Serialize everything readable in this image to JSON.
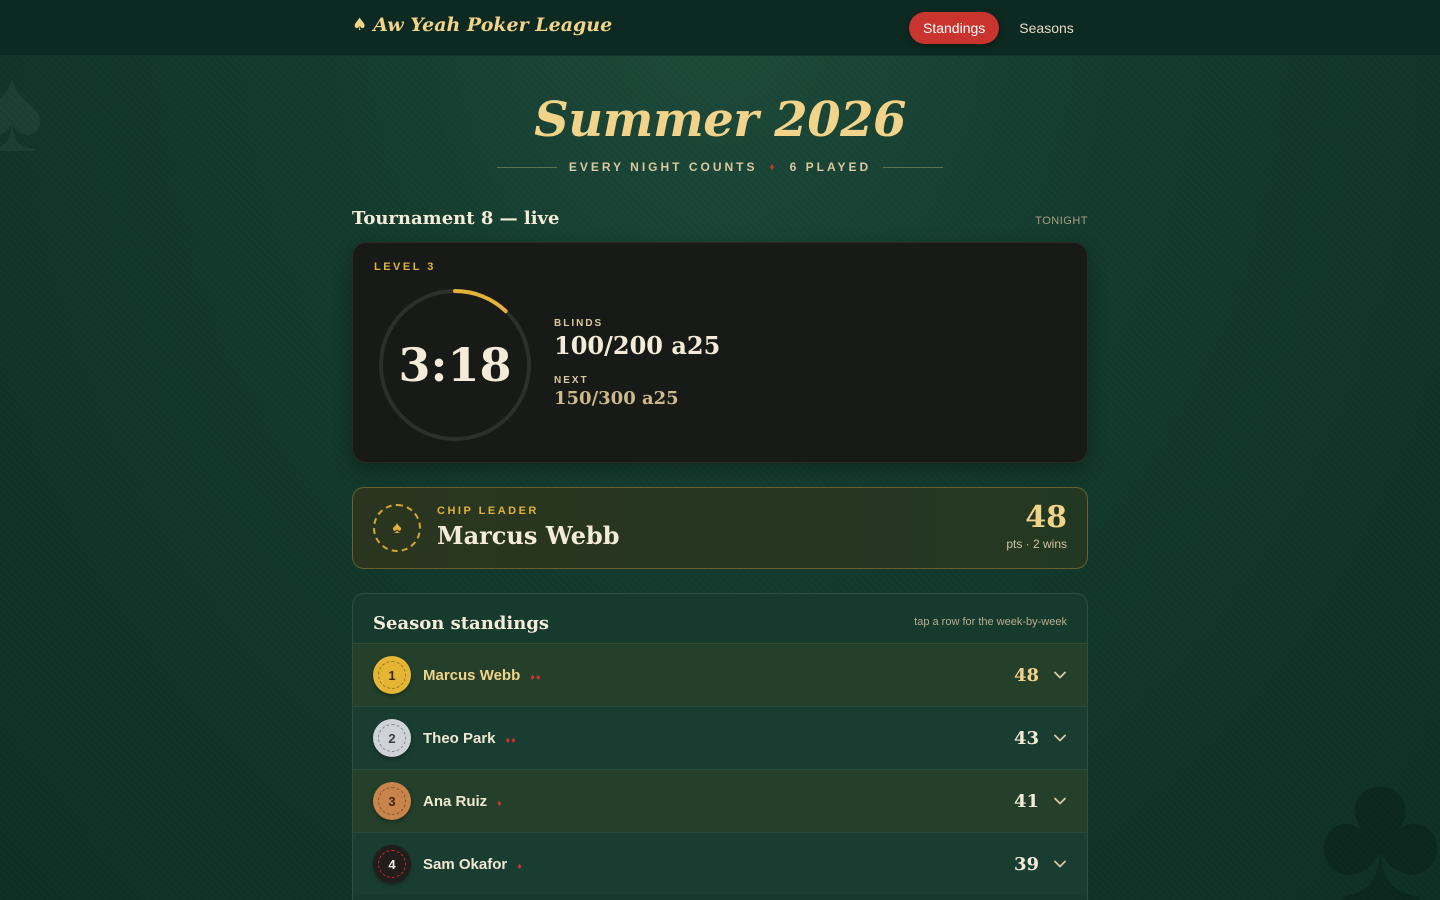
{
  "brand": {
    "icon": "spade-icon",
    "name": "Aw Yeah Poker League"
  },
  "nav": [
    {
      "label": "Standings",
      "active": true
    },
    {
      "label": "Seasons",
      "active": false
    }
  ],
  "hero": {
    "title": "Summer 2026",
    "tagline": "EVERY NIGHT COUNTS",
    "separator": "♦",
    "played": "6 PLAYED"
  },
  "tournament": {
    "title": "Tournament 8 — live",
    "tag": "TONIGHT",
    "level_label": "LEVEL 3",
    "clock": "3:18",
    "level_progress": 0.12,
    "blinds_label": "BLINDS",
    "blinds": "100/200 a25",
    "next_label": "NEXT",
    "next": "150/300 a25"
  },
  "leader": {
    "label": "CHIP LEADER",
    "name": "Marcus Webb",
    "points": "48",
    "meta": "pts · 2 wins",
    "icon": "spade-icon"
  },
  "standings": {
    "title": "Season standings",
    "hint": "tap a row for the week-by-week",
    "rows": [
      {
        "rank": "1",
        "name": "Marcus Webb",
        "wins": "♦♦",
        "points": "48"
      },
      {
        "rank": "2",
        "name": "Theo Park",
        "wins": "♦♦",
        "points": "43"
      },
      {
        "rank": "3",
        "name": "Ana Ruiz",
        "wins": "♦",
        "points": "41"
      },
      {
        "rank": "4",
        "name": "Sam Okafor",
        "wins": "♦",
        "points": "39"
      }
    ]
  },
  "colors": {
    "accent_gold": "#f2d38a",
    "accent_red": "#c9342e",
    "felt_green": "#133a2d",
    "card_dark": "#171a17"
  }
}
